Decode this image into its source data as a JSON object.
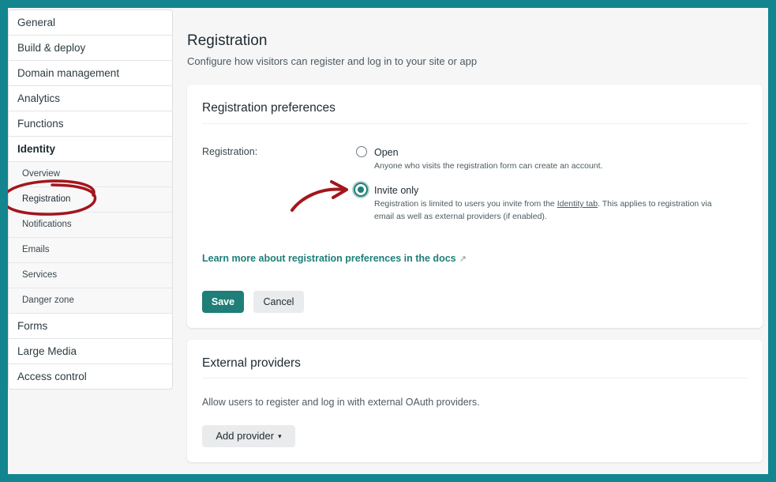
{
  "sidebar": {
    "items": [
      {
        "label": "General"
      },
      {
        "label": "Build & deploy"
      },
      {
        "label": "Domain management"
      },
      {
        "label": "Analytics"
      },
      {
        "label": "Functions"
      },
      {
        "label": "Identity"
      }
    ],
    "subitems": [
      {
        "label": "Overview"
      },
      {
        "label": "Registration"
      },
      {
        "label": "Notifications"
      },
      {
        "label": "Emails"
      },
      {
        "label": "Services"
      },
      {
        "label": "Danger zone"
      }
    ],
    "items_after": [
      {
        "label": "Forms"
      },
      {
        "label": "Large Media"
      },
      {
        "label": "Access control"
      }
    ]
  },
  "page": {
    "title": "Registration",
    "subtitle": "Configure how visitors can register and log in to your site or app"
  },
  "registration_card": {
    "title": "Registration preferences",
    "field_label": "Registration:",
    "options": [
      {
        "label": "Open",
        "desc": "Anyone who visits the registration form can create an account.",
        "selected": false
      },
      {
        "label": "Invite only",
        "desc_before": "Registration is limited to users you invite from the ",
        "desc_link": "Identity tab",
        "desc_after": ". This applies to registration via",
        "desc_line2": "email as well as external providers (if enabled).",
        "selected": true
      }
    ],
    "docs_link": "Learn more about registration preferences in the docs",
    "docs_icon": "↗",
    "save_label": "Save",
    "cancel_label": "Cancel"
  },
  "external_card": {
    "title": "External providers",
    "desc": "Allow users to register and log in with external OAuth providers.",
    "add_label": "Add provider",
    "add_icon": "▾"
  },
  "colors": {
    "accent": "#1f7f78",
    "annotation": "#a3161c",
    "border": "#12858f"
  }
}
